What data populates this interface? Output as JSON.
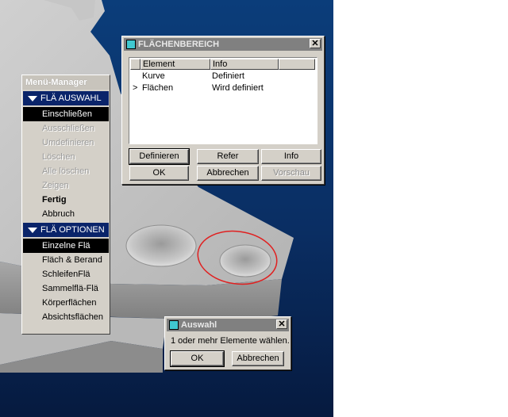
{
  "menu_manager": {
    "title": "Menü-Manager",
    "section1": {
      "title": "FLÄ AUSWAHL"
    },
    "section1_items": [
      {
        "label": "Einschließen",
        "state": "selected"
      },
      {
        "label": "Ausschließen",
        "state": "disabled"
      },
      {
        "label": "Umdefinieren",
        "state": "disabled"
      },
      {
        "label": "Löschen",
        "state": "disabled"
      },
      {
        "label": "Alle löschen",
        "state": "disabled"
      },
      {
        "label": "Zeigen",
        "state": "disabled"
      },
      {
        "label": "Fertig",
        "state": "bold"
      },
      {
        "label": "Abbruch",
        "state": "normal"
      }
    ],
    "section2": {
      "title": "FLÄ OPTIONEN"
    },
    "section2_items": [
      {
        "label": "Einzelne Flä",
        "state": "selected"
      },
      {
        "label": "Fläch & Berand",
        "state": "normal"
      },
      {
        "label": "SchleifenFlä",
        "state": "normal"
      },
      {
        "label": "Sammelflä-Flä",
        "state": "normal"
      },
      {
        "label": "Körperflächen",
        "state": "normal"
      },
      {
        "label": "Absichtsflächen",
        "state": "normal"
      }
    ]
  },
  "flaechenbereich": {
    "title": "FLÄCHENBEREICH",
    "close": "✕",
    "columns": {
      "element": "Element",
      "info": "Info"
    },
    "rows": [
      {
        "marker": "",
        "element": "Kurve",
        "info": "Definiert"
      },
      {
        "marker": ">",
        "element": "Flächen",
        "info": "Wird definiert"
      }
    ],
    "buttons": {
      "definieren": "Definieren",
      "refer": "Refer",
      "info": "Info",
      "ok": "OK",
      "abbrechen": "Abbrechen",
      "vorschau": "Vorschau"
    }
  },
  "auswahl": {
    "title": "Auswahl",
    "close": "✕",
    "message": "1 oder mehr Elemente wählen.",
    "buttons": {
      "ok": "OK",
      "abbrechen": "Abbrechen"
    }
  },
  "colors": {
    "viewport_background": "#0a2e63",
    "part_gray": "#bdbdbd",
    "selection_highlight": "#e02020",
    "menu_section": "#0a246a"
  }
}
